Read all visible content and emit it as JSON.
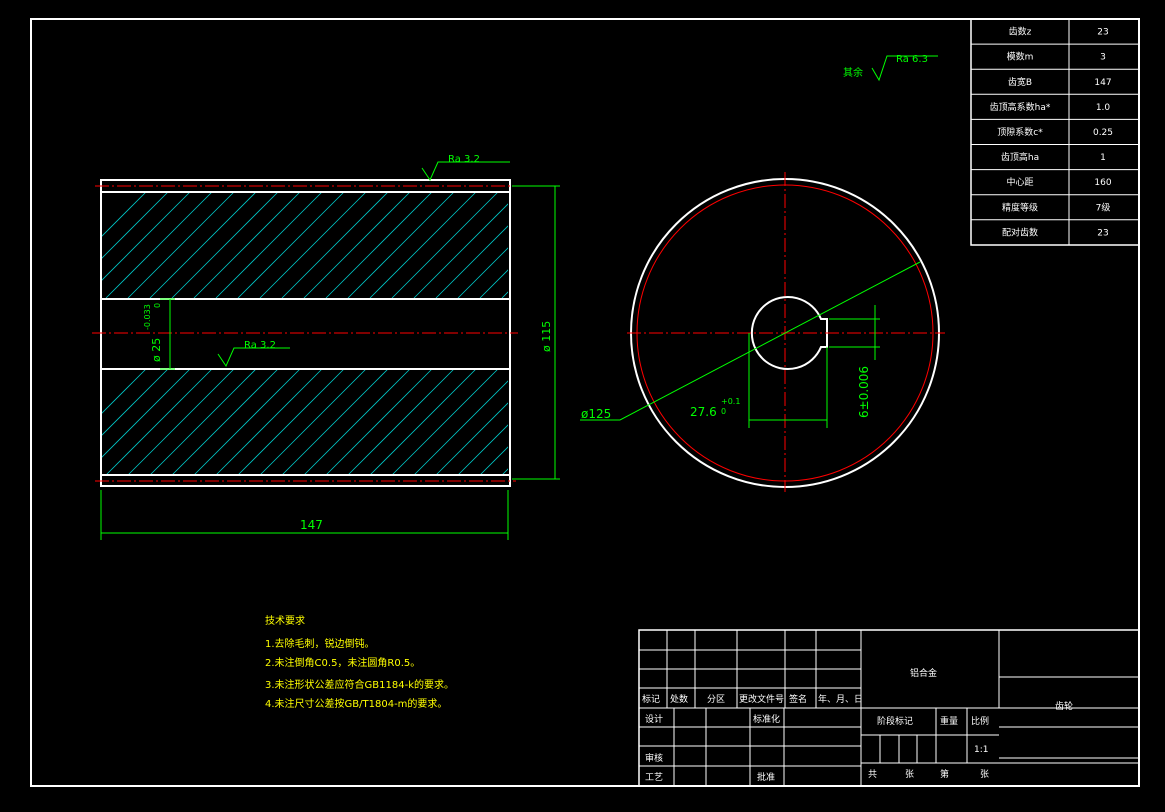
{
  "param_table": [
    {
      "label": "齿数z",
      "value": "23"
    },
    {
      "label": "模数m",
      "value": "3"
    },
    {
      "label": "齿宽B",
      "value": "147"
    },
    {
      "label": "齿顶高系数ha*",
      "value": "1.0"
    },
    {
      "label": "顶隙系数c*",
      "value": "0.25"
    },
    {
      "label": "齿顶高ha",
      "value": "1"
    },
    {
      "label": "中心距",
      "value": "160"
    },
    {
      "label": "精度等级",
      "value": "7级"
    },
    {
      "label": "配对齿数",
      "value": "23"
    }
  ],
  "roughness": {
    "others_prefix": "其余",
    "others_value": "Ra 6.3",
    "top_value": "Ra 3.2",
    "bore_value": "Ra 3.2"
  },
  "dimensions": {
    "width": "147",
    "outer_dia": "ø 115",
    "bore_dia": "ø 25",
    "bore_tol_upper": "-0.033",
    "bore_tol_lower": "0",
    "circle_dia": "ø125",
    "key_depth": "27.6",
    "key_depth_tol_upper": "+0.1",
    "key_depth_tol_lower": "0",
    "key_width": "6±0.006"
  },
  "tech_requirements": {
    "title": "技术要求",
    "items": [
      "1.去除毛刺，锐边倒钝。",
      "2.未注倒角C0.5，未注圆角R0.5。",
      "3.未注形状公差应符合GB1184-k的要求。",
      "4.未注尺寸公差按GB/T1804-m的要求。"
    ]
  },
  "title_block": {
    "material": "铝合金",
    "part_name": "齿轮",
    "rev_headers": [
      "标记",
      "处数",
      "分区",
      "更改文件号",
      "签名",
      "年、月、日"
    ],
    "design": "设计",
    "standardize": "标准化",
    "check": "审核",
    "process": "工艺",
    "approve": "批准",
    "stage_mark": "阶段标记",
    "weight": "重量",
    "scale": "比例",
    "scale_value": "1:1",
    "total": "共",
    "sheet_unit": "张",
    "page": "第",
    "page_unit": "张"
  },
  "colors": {
    "background": "#000000",
    "outline": "#ffffff",
    "dimension": "#00ff00",
    "centerline": "#ff0000",
    "hatch": "#00c8c8",
    "text_yellow": "#ffff00"
  }
}
